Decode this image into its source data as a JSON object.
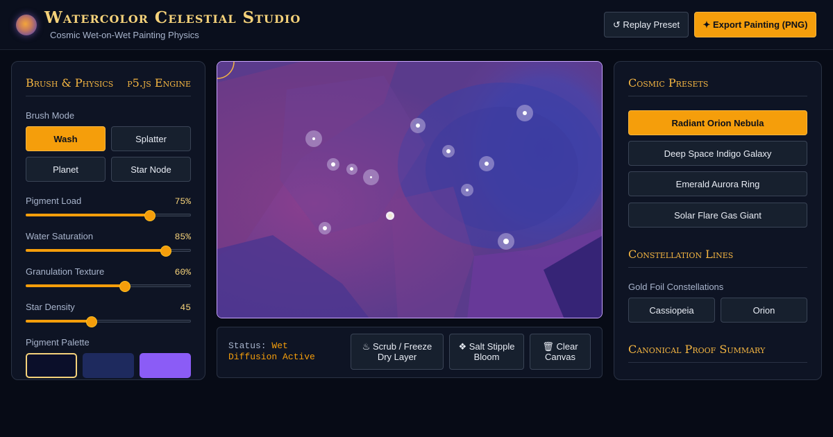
{
  "header": {
    "title": "Watercolor Celestial Studio",
    "subtitle": "Cosmic Wet-on-Wet Painting Physics",
    "replay_label": "↺ Replay Preset",
    "export_label": "✦ Export Painting (PNG)"
  },
  "left_panel": {
    "title": "Brush & Physics",
    "engine": "p5.js Engine",
    "brush_mode_label": "Brush Mode",
    "modes": [
      {
        "label": "Wash",
        "active": true
      },
      {
        "label": "Splatter",
        "active": false
      },
      {
        "label": "Planet",
        "active": false
      },
      {
        "label": "Star Node",
        "active": false
      }
    ],
    "sliders": [
      {
        "label": "Pigment Load",
        "display": "75%",
        "fraction": 0.75
      },
      {
        "label": "Water Saturation",
        "display": "85%",
        "fraction": 0.85
      },
      {
        "label": "Granulation Texture",
        "display": "60%",
        "fraction": 0.6
      },
      {
        "label": "Star Density",
        "display": "45",
        "fraction": 0.4
      }
    ],
    "palette_label": "Pigment Palette",
    "palette": [
      "#0b0f2a",
      "#1e2a5e",
      "#8b5cf6"
    ]
  },
  "status": {
    "prefix": "Status:",
    "value": "Wet Diffusion Active",
    "actions": [
      "♨ Scrub / Freeze Dry Layer",
      "❖ Salt Stipple Bloom",
      "🗑 Clear Canvas"
    ]
  },
  "right_panel": {
    "presets_title": "Cosmic Presets",
    "presets": [
      {
        "label": "Radiant Orion Nebula",
        "active": true
      },
      {
        "label": "Deep Space Indigo Galaxy",
        "active": false
      },
      {
        "label": "Emerald Aurora Ring",
        "active": false
      },
      {
        "label": "Solar Flare Gas Giant",
        "active": false
      }
    ],
    "constellation_title": "Constellation Lines",
    "gold_foil_label": "Gold Foil Constellations",
    "constellations": [
      "Cassiopeia",
      "Orion"
    ],
    "proof_title": "Canonical Proof Summary"
  },
  "colors": {
    "accent": "#f59e0b",
    "gold_text": "#f5d27a",
    "background": "#070b16",
    "panel": "#0e1424"
  }
}
